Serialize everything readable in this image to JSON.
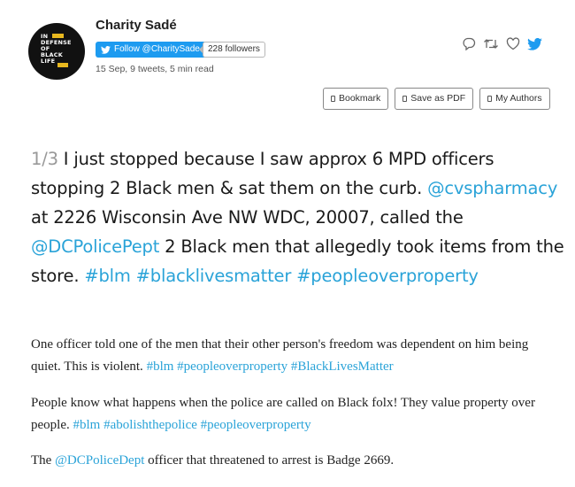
{
  "author": {
    "name": "Charity Sadé",
    "avatar_lines": [
      "IN",
      "DEFENSE",
      "OF",
      "BLACK",
      "LIFE"
    ]
  },
  "follow_button": {
    "label": "Follow @CharitySade",
    "icon": "twitter-bird-icon"
  },
  "followers": {
    "label": "228 followers"
  },
  "meta": "15 Sep, 9 tweets, 5 min read",
  "actions": {
    "icons": [
      "reply-icon",
      "retweet-icon",
      "like-icon",
      "twitter-icon"
    ]
  },
  "toolbar": {
    "bookmark": "Bookmark",
    "save_pdf": "Save as PDF",
    "my_authors": "My Authors"
  },
  "lead": {
    "counter": "1/3",
    "t1": " I just stopped because I saw approx 6 MPD officers stopping 2 Black men & sat them on the curb. ",
    "mention1": "@cvspharmacy",
    "t2": " at 2226 Wisconsin Ave NW WDC, 20007, called the ",
    "mention2": "@DCPolicePept",
    "t3": " 2 Black men that allegedly took items from the store. ",
    "tag1": "#blm",
    "tag2": "#blacklivesmatter",
    "tag3": "#peopleoverproperty"
  },
  "para1": {
    "text": "One officer told one of the men that their other person's freedom was dependent on him being quiet. This is violent. ",
    "tag1": "#blm",
    "tag2": "#peopleoverproperty",
    "tag3": "#BlackLivesMatter"
  },
  "para2": {
    "text": "People know what happens when the police are called on Black folx! They value property over people. ",
    "tag1": "#blm",
    "tag2": "#abolishthepolice",
    "tag3": "#peopleoverproperty"
  },
  "para3": {
    "t1": "The ",
    "mention": "@DCPoliceDept",
    "t2": " officer that threatened to arrest is Badge 2669."
  },
  "colors": {
    "link": "#2aa3d8",
    "follow_bg": "#1d9bf0",
    "counter": "#999999"
  }
}
